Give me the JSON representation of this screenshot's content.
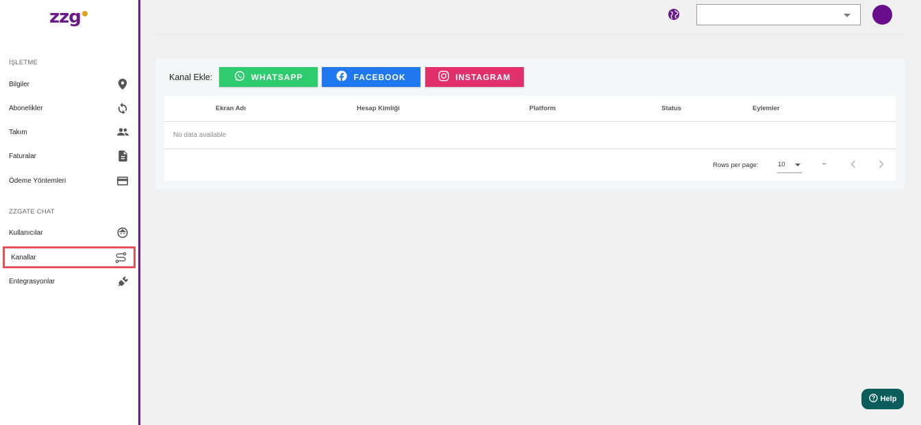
{
  "logo": {
    "text": "zzg"
  },
  "sidebar": {
    "sections": [
      {
        "label": "İŞLETME"
      },
      {
        "label": "ZZGATE CHAT"
      }
    ],
    "items": [
      {
        "label": "Bilgiler",
        "icon": "location-pin-icon"
      },
      {
        "label": "Abonelikler",
        "icon": "sync-icon"
      },
      {
        "label": "Takım",
        "icon": "people-icon"
      },
      {
        "label": "Faturalar",
        "icon": "document-icon"
      },
      {
        "label": "Ödeme Yöntemleri",
        "icon": "credit-card-icon"
      },
      {
        "label": "Kullanıcılar",
        "icon": "face-icon"
      },
      {
        "label": "Kanallar",
        "icon": "route-icon",
        "active": true
      },
      {
        "label": "Entegrasyonlar",
        "icon": "plug-icon"
      }
    ]
  },
  "topbar": {
    "language_icon": "globe-icon",
    "select_value": "",
    "avatar_color": "#6a0d8d"
  },
  "channels": {
    "add_label": "Kanal Ekle:",
    "buttons": [
      {
        "label": "WHATSAPP",
        "icon": "whatsapp-icon",
        "color": "#2ecc6e"
      },
      {
        "label": "FACEBOOK",
        "icon": "facebook-icon",
        "color": "#1f78f0"
      },
      {
        "label": "INSTAGRAM",
        "icon": "instagram-icon",
        "color": "#e2306c"
      }
    ]
  },
  "table": {
    "columns": [
      "Ekran Adı",
      "Hesap Kimliği",
      "Platform",
      "Status",
      "Eylemler"
    ],
    "empty_text": "No data available",
    "footer": {
      "rows_per_page_label": "Rows per page:",
      "rows_per_page_value": "10",
      "range_text": "–"
    }
  },
  "help": {
    "label": "Help"
  },
  "colors": {
    "brand": "#6a1b8a",
    "active_outline": "#e8505b"
  }
}
